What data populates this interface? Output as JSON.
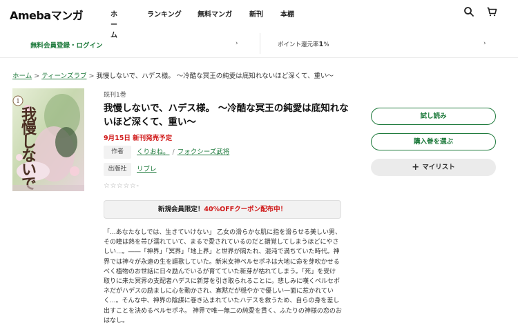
{
  "header": {
    "logo": "Amebaマンガ",
    "nav": [
      "ホーム",
      "ランキング",
      "無料マンガ",
      "新刊",
      "本棚"
    ]
  },
  "subbar": {
    "signup": "無料会員登録・ログイン",
    "points_label": "ポイント還元率",
    "points_value": "1",
    "points_unit": "%",
    "arrow": "›"
  },
  "breadcrumb": {
    "home": "ホーム",
    "category": "ティーンズラブ",
    "current": "我慢しないで、ハデス様。 〜冷酷な冥王の純愛は底知れないほど深くて、重い〜",
    "sep": ">"
  },
  "book": {
    "status": "既刊1巻",
    "title": "我慢しないで、ハデス様。 〜冷酷な冥王の純愛は底知れないほど深くて、重い〜",
    "release": "9月15日 新刊発売予定",
    "author_label": "作者",
    "authors": [
      "くりおね。",
      "フォクシーズ武将"
    ],
    "author_slash": "/",
    "publisher_label": "出版社",
    "publisher": "リブレ",
    "rating_stars": "☆☆☆☆☆",
    "rating_value": "-"
  },
  "coupon": {
    "prefix": "新規会員限定！",
    "highlight": "40%OFFクーポン配布中！"
  },
  "description": "「...あなたなしでは、生きていけない」 乙女の滑らかな肌に指を滑らせる美しい男、その瞳は熱を帯び濡れていて、まるで愛されているのだと錯覚してしまうほどにやさしい...。――「神界」「冥界」「地上界」と世界が隔たれ、混沌で満ちていた時代。神界では神々が永遠の生を謳歌していた。新米女神ペルセポネは大地に命を芽吹かせるべく植物のお世話に日々励んでいるが育てていた新芽が枯れてしまう。「死」を受け取りに来た冥界の支配者ハデスに新芽を引き取られることに。悲しみに嘆くペルセポネだがハデスの励ましに心を動かされ、寡黙だが穏やかで優しい一面に惹かれていく...。そんな中、神界の陰謀に巻き込まれていたハデスを救うため、自らの身を差し出すことを決めるペルセポネ。 神界で唯一無二の純愛を貫く、ふたりの神様の恋のおはなし。",
  "actions": {
    "trial": "試し読み",
    "select_volume": "購入巻を選ぶ",
    "mylist": "マイリスト",
    "mylist_icon": "+"
  },
  "cover_art": {
    "vertical_title": "我慢しないでハデス様",
    "volume": "1"
  },
  "colors": {
    "accent_green": "#1e7a3c",
    "alert_red": "#d01818"
  }
}
